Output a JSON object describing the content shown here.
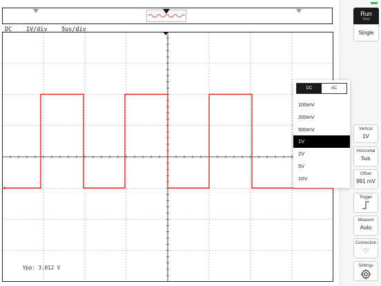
{
  "status": {
    "coupling": "DC",
    "volts_div": "1V/div",
    "time_div": "5us/div"
  },
  "measurement": {
    "vpp_text": "Vpp: 3.012 V"
  },
  "trigger_level_label": "1",
  "controls": {
    "run_label": "Run",
    "stop_label": "Stop",
    "single_label": "Single",
    "vertical": {
      "caption": "Vertical",
      "value": "1V"
    },
    "horizontal": {
      "caption": "Horizontal",
      "value": "5us"
    },
    "offset": {
      "caption": "Offset",
      "value": "991 mV"
    },
    "trigger": {
      "caption": "Trigger",
      "icon": "rising-edge-icon"
    },
    "measure": {
      "caption": "Measure",
      "value": "Auto"
    },
    "connection": {
      "caption": "Connection",
      "icon": "wifi-icon"
    },
    "settings": {
      "caption": "Settings",
      "icon": "gear-icon"
    }
  },
  "dropdown": {
    "coupling_options": [
      "DC",
      "AC"
    ],
    "coupling_selected": "DC",
    "options": [
      "100mV",
      "200mV",
      "500mV",
      "1V",
      "2V",
      "5V",
      "10V"
    ],
    "selected": "1V"
  },
  "colors": {
    "trace": "#e0261e",
    "accent_dark": "#1a1a1a",
    "battery": "#2bbf4a"
  }
}
